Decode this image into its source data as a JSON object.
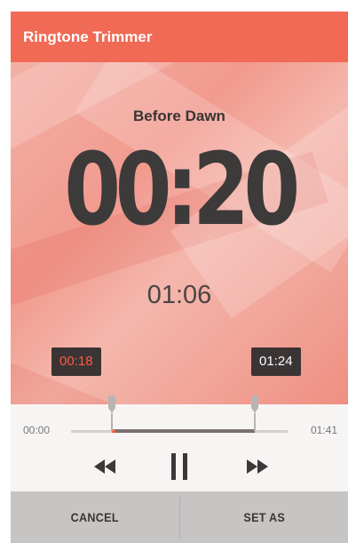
{
  "app": {
    "title": "Ringtone Trimmer"
  },
  "player": {
    "song_title": "Before Dawn",
    "current_time": "00:20",
    "clip_duration": "01:06",
    "start_marker": "00:18",
    "end_marker": "01:24"
  },
  "timeline": {
    "start_label": "00:00",
    "end_label": "01:41",
    "selection_start_seconds": 18,
    "selection_end_seconds": 84,
    "total_seconds": 101
  },
  "controls": {
    "rewind_icon": "rewind-icon",
    "pause_icon": "pause-icon",
    "forward_icon": "fast-forward-icon"
  },
  "actions": {
    "cancel_label": "CANCEL",
    "set_as_label": "SET AS"
  },
  "colors": {
    "accent": "#f06a55",
    "marker_bg": "#3b3434",
    "start_marker_text": "#ff5c44"
  }
}
